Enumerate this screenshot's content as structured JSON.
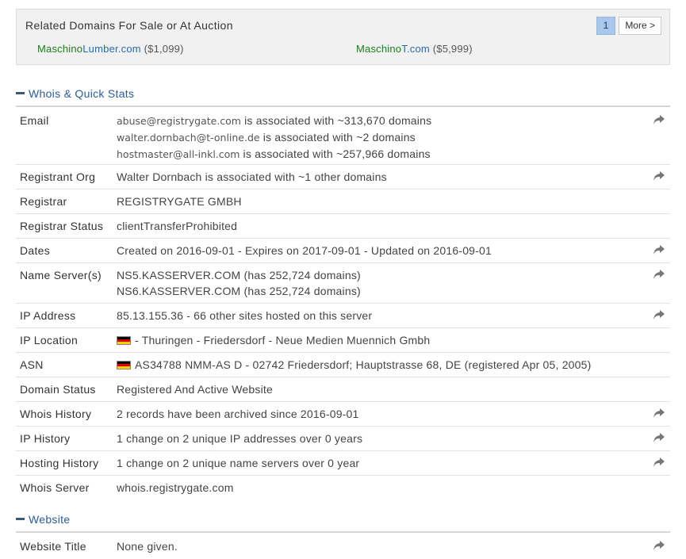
{
  "related": {
    "title": "Related Domains For Sale or At Auction",
    "items": [
      {
        "name_a": "Maschino",
        "name_b": "Lumber.com",
        "price": "($1,099)"
      },
      {
        "name_a": "Maschino",
        "name_b": "T.com",
        "price": "($5,999)"
      }
    ],
    "pager": {
      "current": "1",
      "more": "More >"
    }
  },
  "whois_section": {
    "title": "Whois & Quick Stats",
    "rows": [
      {
        "label": "Email",
        "lines": [
          {
            "email": "abuse@registrygate.com",
            "text": " is associated with ~313,670 domains"
          },
          {
            "email": "walter.dornbach@t-online.de",
            "text": " is associated with ~2 domains"
          },
          {
            "email": "hostmaster@all-inkl.com",
            "text": " is associated with ~257,966 domains"
          }
        ],
        "share": true
      },
      {
        "label": "Registrant Org",
        "value": "Walter Dornbach is associated with ~1 other domains",
        "share": true
      },
      {
        "label": "Registrar",
        "value": "REGISTRYGATE GMBH",
        "share": false
      },
      {
        "label": "Registrar Status",
        "value": "clientTransferProhibited",
        "share": false
      },
      {
        "label": "Dates",
        "value": "Created on 2016-09-01 - Expires on 2017-09-01 - Updated on 2016-09-01",
        "share": true
      },
      {
        "label": "Name Server(s)",
        "lines": [
          "NS5.KASSERVER.COM (has 252,724 domains)",
          "NS6.KASSERVER.COM (has 252,724 domains)"
        ],
        "share": true
      },
      {
        "label": "IP Address",
        "value": "85.13.155.36 - 66 other sites hosted on this server",
        "share": true
      },
      {
        "label": "IP Location",
        "value": "- Thuringen - Friedersdorf - Neue Medien Muennich Gmbh",
        "flag": "germany-flag",
        "share": false
      },
      {
        "label": "ASN",
        "value": "AS34788 NMM-AS D - 02742 Friedersdorf; Hauptstrasse 68, DE (registered Apr 05, 2005)",
        "flag": "germany-flag",
        "share": false
      },
      {
        "label": "Domain Status",
        "value": "Registered And Active Website",
        "share": false
      },
      {
        "label": "Whois History",
        "value": "2 records have been archived since 2016-09-01",
        "share": true
      },
      {
        "label": "IP History",
        "value": "1 change on 2 unique IP addresses over 0 years",
        "share": true
      },
      {
        "label": "Hosting History",
        "value": "1 change on 2 unique name servers over 0 year",
        "share": true
      },
      {
        "label": "Whois Server",
        "value": "whois.registrygate.com",
        "share": false
      }
    ]
  },
  "website_section": {
    "title": "Website",
    "rows": [
      {
        "label": "Website Title",
        "value": "None given.",
        "share": true
      }
    ]
  },
  "colors": {
    "accent": "#2a5d9f",
    "link_green": "#1a7f1a",
    "link_blue": "#2a6ab0",
    "pager_active": "#a9c7ea"
  },
  "icons": {
    "share": "share-arrow-icon",
    "collapse": "minus-icon",
    "flag": "germany-flag"
  }
}
